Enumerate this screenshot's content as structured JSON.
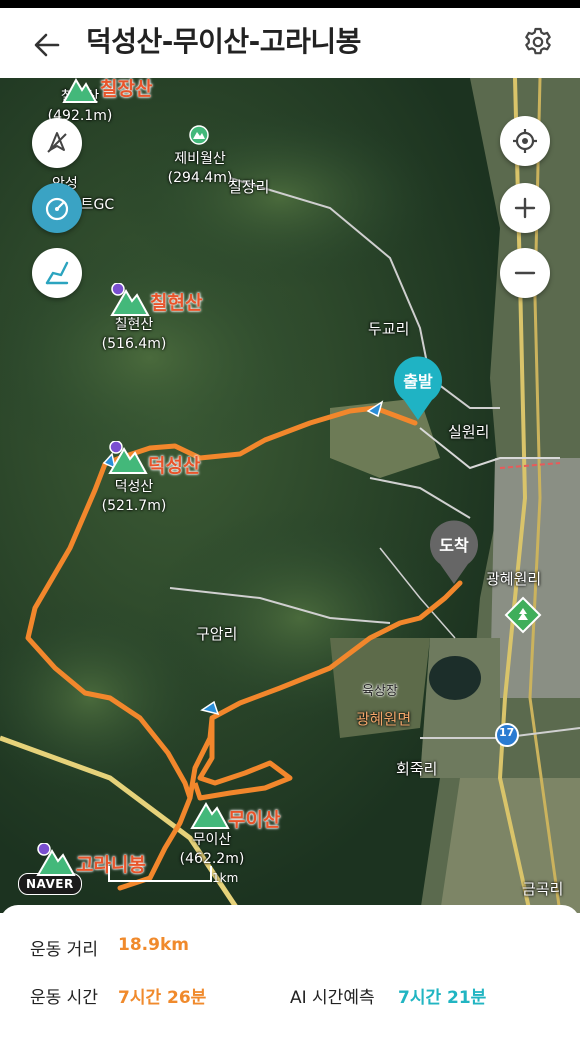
{
  "header": {
    "title": "덕성산-무이산-고라니봉",
    "back_icon": "back-arrow-icon",
    "settings_icon": "gear-icon"
  },
  "map": {
    "controls": {
      "left": [
        "compass-off-icon",
        "speedometer-icon",
        "route-icon"
      ],
      "right": [
        "locate-icon",
        "zoom-in-icon",
        "zoom-out-icon"
      ]
    },
    "peaks": [
      {
        "name": "칠장산",
        "sub": "칠장산\n(492.1m)"
      },
      {
        "name": "칠현산",
        "sub": "칠현산\n(516.4m)"
      },
      {
        "name": "덕성산",
        "sub": "덕성산\n(521.7m)"
      },
      {
        "name": "무이산",
        "sub": "무이산\n(462.2m)"
      },
      {
        "name": "고라니봉",
        "sub": ""
      }
    ],
    "minor_peak": {
      "sub": "제비월산\n(294.4m)"
    },
    "places": [
      "칠장리",
      "안성",
      "베네스트GC",
      "두교리",
      "실원리",
      "광혜원리",
      "구암리",
      "육상장",
      "광혜원면",
      "회죽리",
      "금곡리"
    ],
    "road_number": "17",
    "start_label": "출발",
    "end_label": "도착",
    "start_color": "#1fb3c4",
    "end_color": "#666666",
    "route_color": "#f2872c",
    "logo": "NAVER",
    "scale_label": "1km"
  },
  "stats": {
    "distance_label": "운동 거리",
    "distance_value": "18.9km",
    "time_label": "운동 시간",
    "time_value": "7시간 26분",
    "ai_label": "AI 시간예측",
    "ai_value": "7시간 21분"
  }
}
